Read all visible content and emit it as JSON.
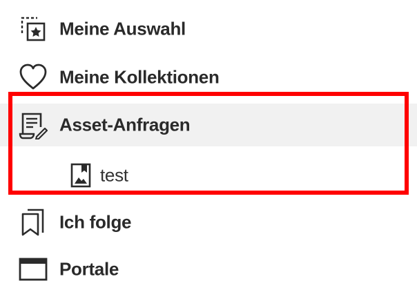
{
  "nav": {
    "items": [
      {
        "label": "Meine Auswahl",
        "icon": "selection-star-icon"
      },
      {
        "label": "Meine Kollektionen",
        "icon": "heart-icon"
      },
      {
        "label": "Asset-Anfragen",
        "icon": "document-edit-icon"
      },
      {
        "label": "test",
        "icon": "image-bookmark-icon"
      },
      {
        "label": "Ich folge",
        "icon": "bookmarks-icon"
      },
      {
        "label": "Portale",
        "icon": "window-icon"
      }
    ]
  },
  "colors": {
    "highlight_border": "#ff0000",
    "selected_background": "#f1f1f1",
    "text": "#2a2a2a"
  }
}
